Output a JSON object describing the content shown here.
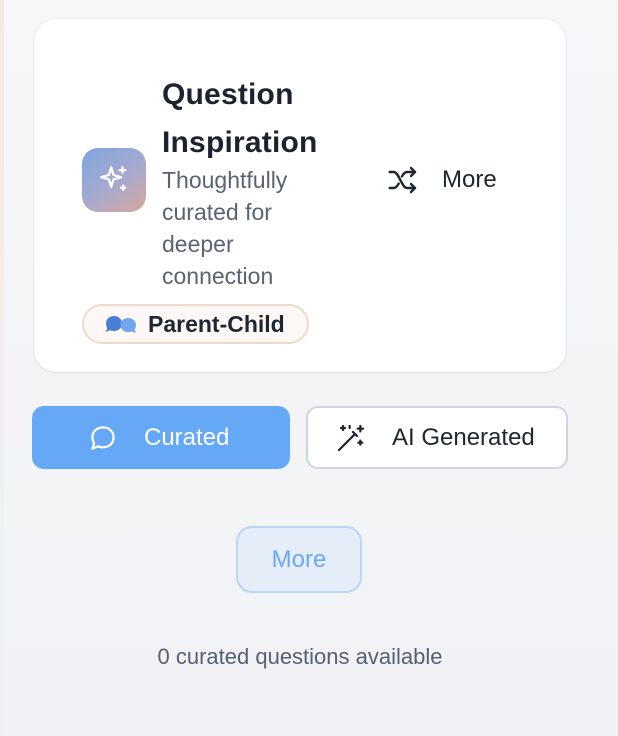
{
  "card": {
    "title": "Question Inspiration",
    "subtitle": "Thoughtfully curated for deeper connection",
    "app_icon": "sparkles-icon",
    "more_label": "More",
    "more_icon": "shuffle-icon",
    "tag": {
      "icon": "speech-bubbles-icon",
      "label": "Parent-Child"
    }
  },
  "tabs": [
    {
      "label": "Curated",
      "icon": "chat-bubble-icon",
      "active": true
    },
    {
      "label": "AI Generated",
      "icon": "magic-wand-icon",
      "active": false
    }
  ],
  "more_button": {
    "label": "More"
  },
  "status": {
    "text": "0 curated questions available"
  },
  "colors": {
    "accent": "#65a8f6",
    "more_button_text": "#6ea9ef",
    "tag_border": "#f1d8cc",
    "tag_icon": "#4a7fd6"
  }
}
